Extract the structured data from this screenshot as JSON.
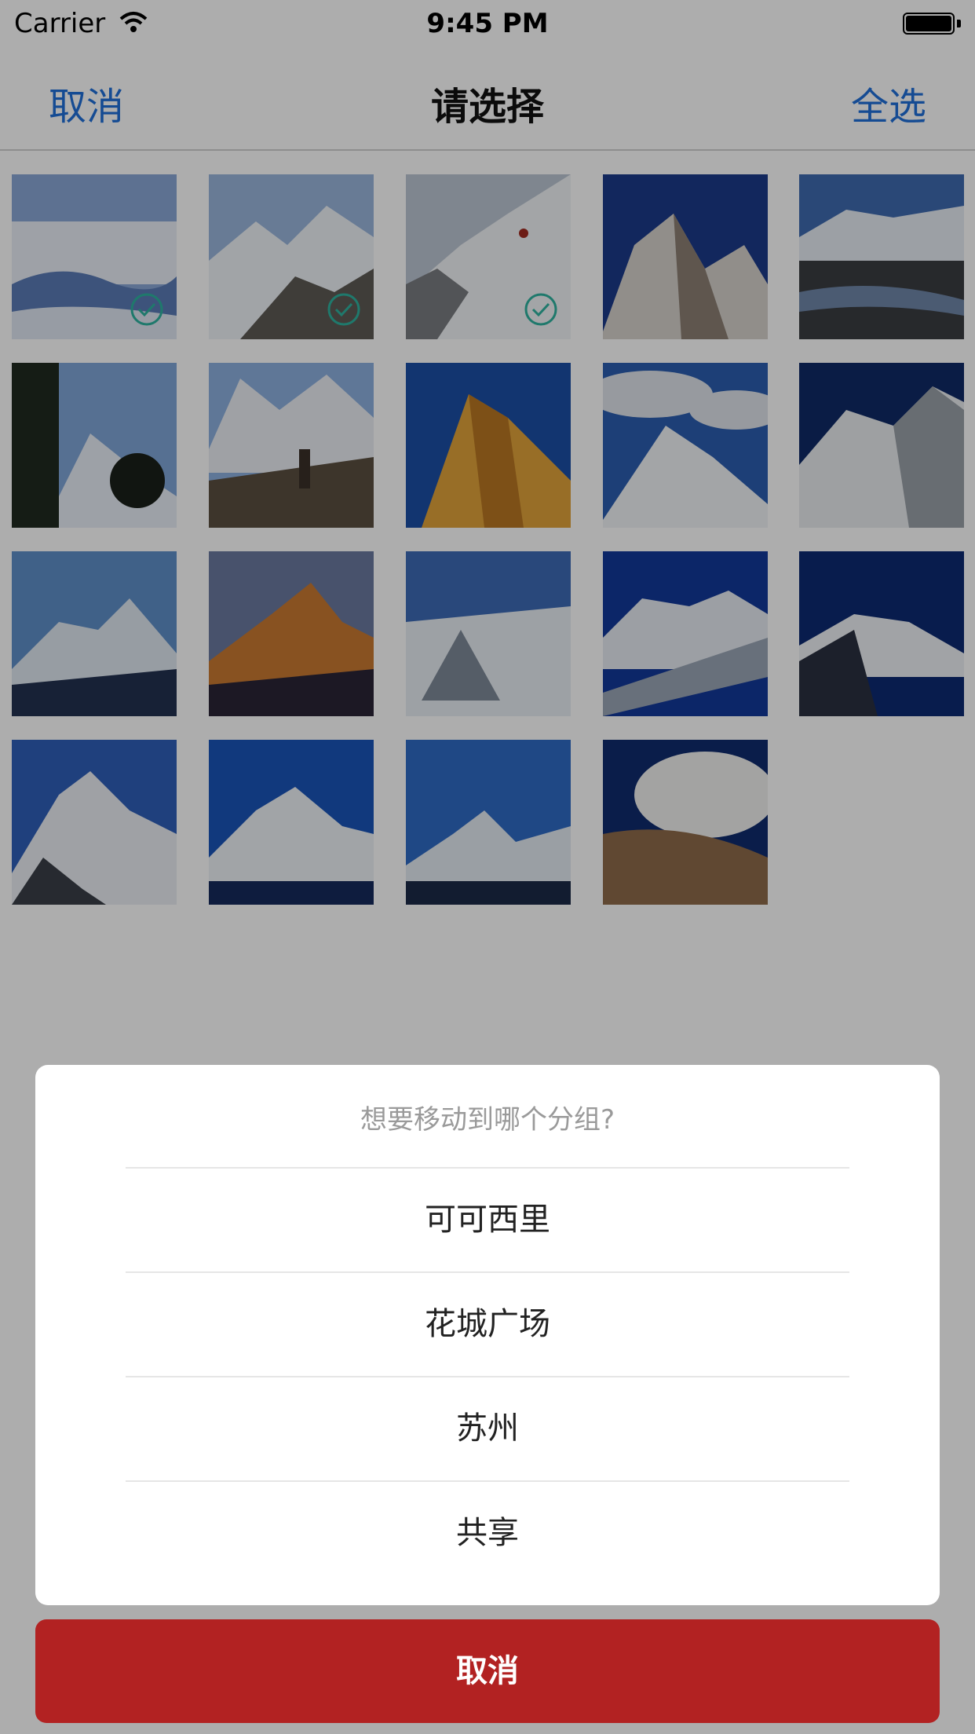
{
  "status_bar": {
    "carrier": "Carrier",
    "time": "9:45 PM"
  },
  "nav": {
    "left": "取消",
    "title": "请选择",
    "right": "全选"
  },
  "photos": [
    {
      "selected": true
    },
    {
      "selected": true
    },
    {
      "selected": true
    },
    {
      "selected": false
    },
    {
      "selected": false
    },
    {
      "selected": false
    },
    {
      "selected": false
    },
    {
      "selected": false
    },
    {
      "selected": false
    },
    {
      "selected": false
    },
    {
      "selected": false
    },
    {
      "selected": false
    },
    {
      "selected": false
    },
    {
      "selected": false
    },
    {
      "selected": false
    },
    {
      "selected": false
    },
    {
      "selected": false
    },
    {
      "selected": false
    },
    {
      "selected": false
    }
  ],
  "action_sheet": {
    "prompt": "想要移动到哪个分组?",
    "options": [
      "可可西里",
      "花城广场",
      "苏州",
      "共享"
    ],
    "cancel": "取消"
  },
  "colors": {
    "accent": "#1f6fd9",
    "cancel": "#b22222",
    "check": "#2fb3a0"
  }
}
